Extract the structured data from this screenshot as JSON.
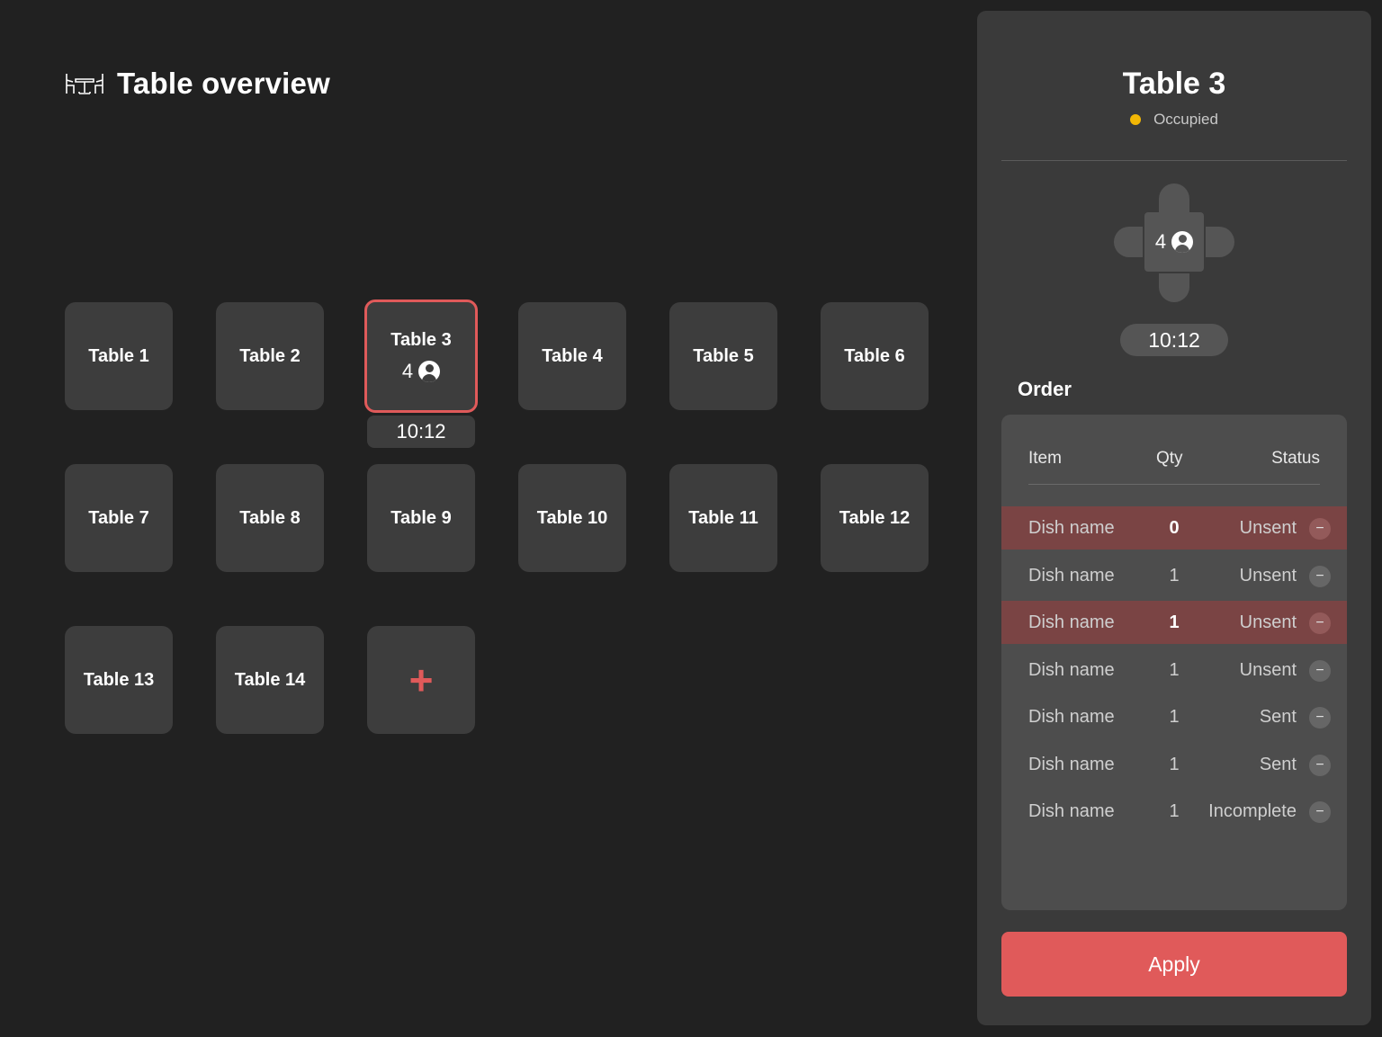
{
  "header": {
    "title": "Table overview",
    "icon": "dining-table-icon"
  },
  "colors": {
    "accent": "#e05a5a",
    "occupied": "#f2b705",
    "background": "#212121",
    "tile": "#3d3d3d"
  },
  "tables": [
    {
      "label": "Table 1"
    },
    {
      "label": "Table 2"
    },
    {
      "label": "Table 3",
      "guests": "4",
      "time": "10:12",
      "selected": true
    },
    {
      "label": "Table 4"
    },
    {
      "label": "Table 5"
    },
    {
      "label": "Table 6"
    },
    {
      "label": "Table 7"
    },
    {
      "label": "Table 8"
    },
    {
      "label": "Table 9"
    },
    {
      "label": "Table 10"
    },
    {
      "label": "Table 11"
    },
    {
      "label": "Table 12"
    },
    {
      "label": "Table 13"
    },
    {
      "label": "Table 14"
    }
  ],
  "add_table": {
    "symbol": "+"
  },
  "panel": {
    "title": "Table 3",
    "status": "Occupied",
    "guests": "4",
    "time": "10:12",
    "order_heading": "Order",
    "columns": {
      "item": "Item",
      "qty": "Qty",
      "status": "Status"
    },
    "rows": [
      {
        "item": "Dish name",
        "qty": "0",
        "status": "Unsent",
        "highlight": true
      },
      {
        "item": "Dish name",
        "qty": "1",
        "status": "Unsent",
        "highlight": false
      },
      {
        "item": "Dish name",
        "qty": "1",
        "status": "Unsent",
        "highlight": true
      },
      {
        "item": "Dish name",
        "qty": "1",
        "status": "Unsent",
        "highlight": false
      },
      {
        "item": "Dish name",
        "qty": "1",
        "status": "Sent",
        "highlight": false
      },
      {
        "item": "Dish name",
        "qty": "1",
        "status": "Sent",
        "highlight": false
      },
      {
        "item": "Dish name",
        "qty": "1",
        "status": "Incomplete",
        "highlight": false
      }
    ],
    "remove_symbol": "−",
    "apply_label": "Apply"
  }
}
